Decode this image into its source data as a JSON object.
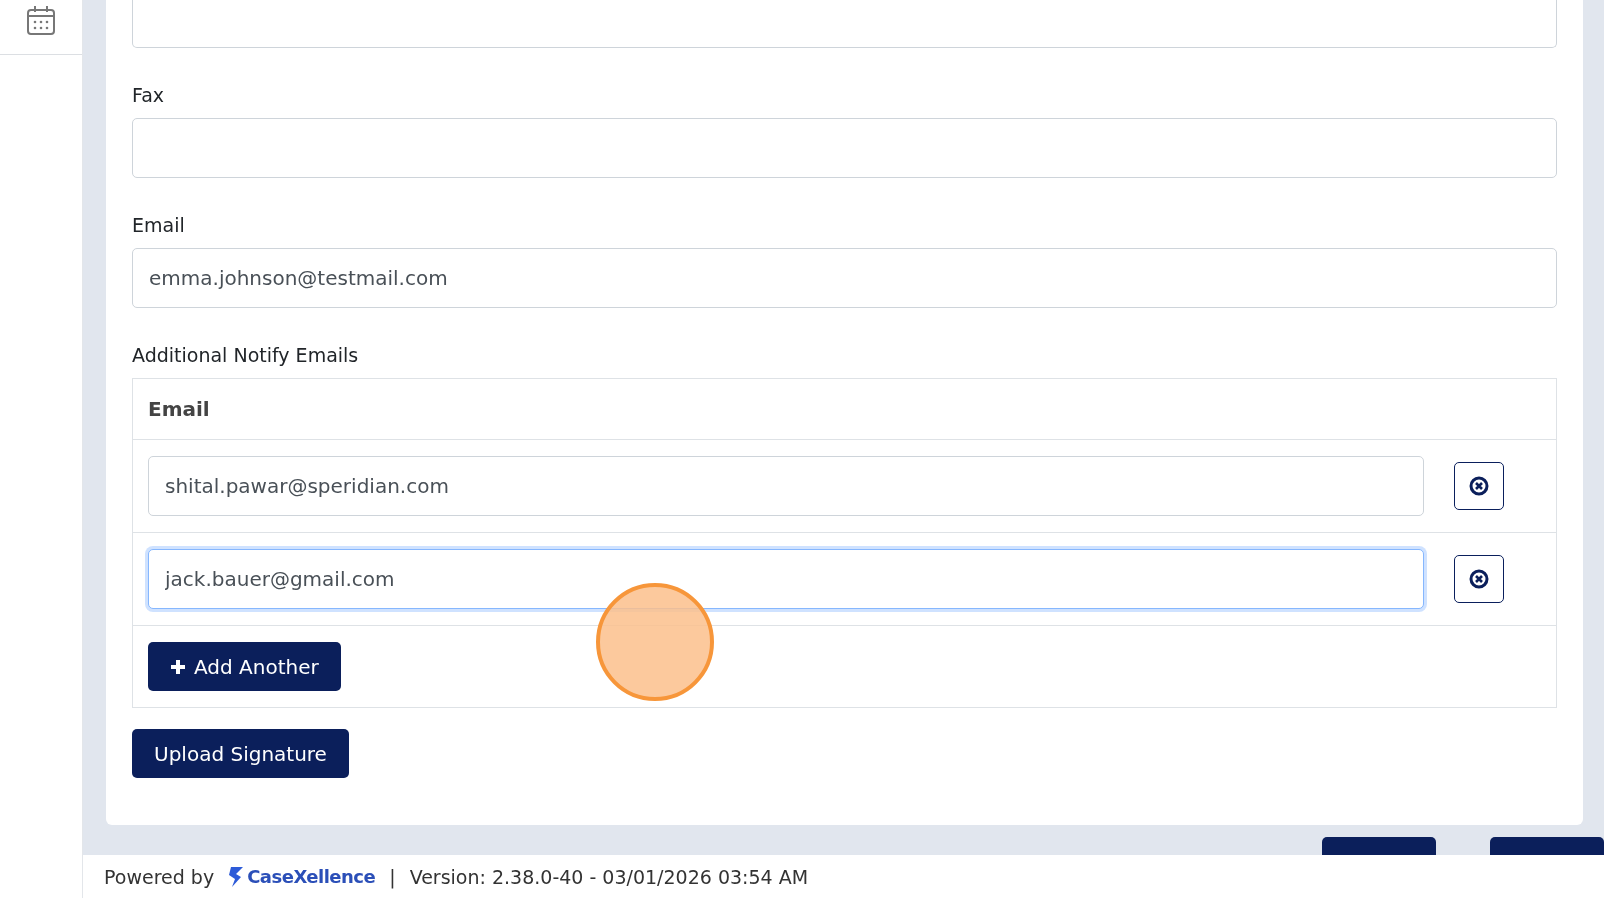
{
  "fields": [
    {
      "label": "Fax"
    },
    {
      "label": "Email",
      "value": "emma.johnson@testmail.com"
    }
  ],
  "notify": {
    "label": "Additional Notify Emails",
    "column": "Email",
    "rows": [
      {
        "value": "shital.pawar@speridian.com",
        "focused": false
      },
      {
        "value": "jack.bauer@gmail.com",
        "focused": true
      }
    ],
    "add_button": "Add Another"
  },
  "upload_button": "Upload Signature",
  "footer": {
    "powered_by": "Powered by",
    "brand": "CaseXellence",
    "separator": "|",
    "version": "Version: 2.38.0-40 - 03/01/2026 03:54 AM"
  }
}
